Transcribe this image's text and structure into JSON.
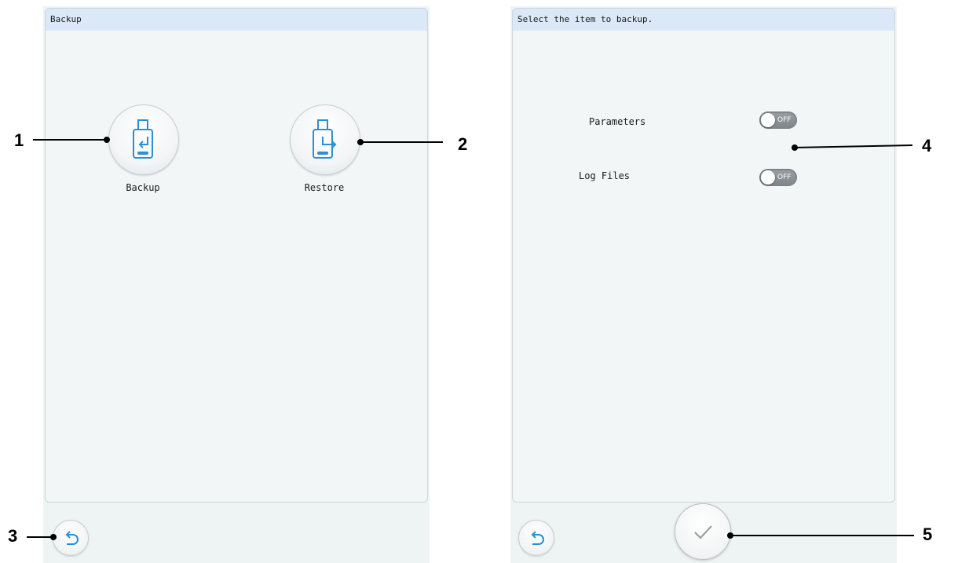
{
  "left_panel": {
    "header": "Backup",
    "backup_button": {
      "label": "Backup",
      "icon": "usb-import-icon"
    },
    "restore_button": {
      "label": "Restore",
      "icon": "usb-export-icon"
    },
    "back_button": {
      "icon": "undo-arrow-icon"
    }
  },
  "right_panel": {
    "header": "Select the item to backup.",
    "items": [
      {
        "label": "Parameters",
        "toggle_state": "OFF"
      },
      {
        "label": "Log Files",
        "toggle_state": "OFF"
      }
    ],
    "back_button": {
      "icon": "undo-arrow-icon"
    },
    "confirm_button": {
      "icon": "checkmark-icon"
    }
  },
  "callouts": [
    "1",
    "2",
    "3",
    "4",
    "5"
  ],
  "colors": {
    "accent_blue": "#2b8fd6",
    "header_bg": "#dbe8f7",
    "panel_bg": "#f2f6f7",
    "toggle_off": "#8a9094"
  }
}
